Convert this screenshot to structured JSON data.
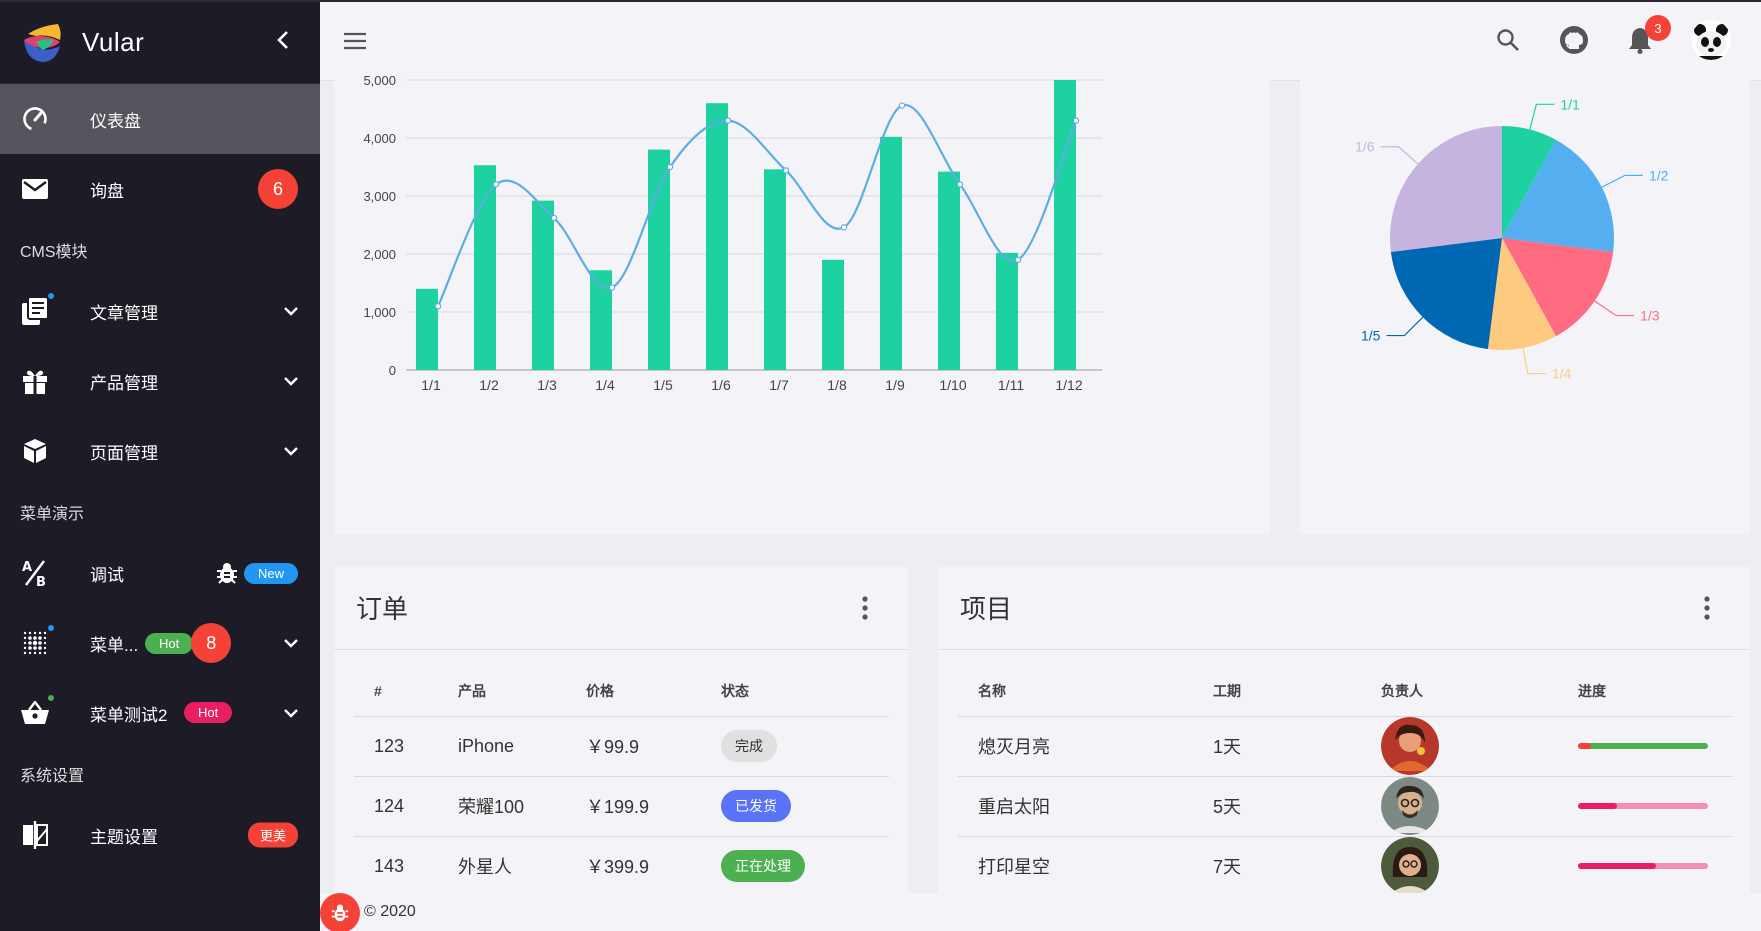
{
  "app": {
    "name": "Vular"
  },
  "sidebar": {
    "items": [
      {
        "label": "仪表盘",
        "icon": "speedometer-icon"
      },
      {
        "label": "询盘",
        "icon": "mail-icon",
        "badge": "6"
      }
    ],
    "sections": [
      {
        "title": "CMS模块",
        "items": [
          {
            "label": "文章管理",
            "icon": "articles-icon"
          },
          {
            "label": "产品管理",
            "icon": "gift-icon"
          },
          {
            "label": "页面管理",
            "icon": "cube-icon"
          }
        ]
      },
      {
        "title": "菜单演示",
        "items": [
          {
            "label": "调试",
            "icon": "debug-icon",
            "pill": "New"
          },
          {
            "label": "菜单...",
            "icon": "grid-dots-icon",
            "pill": "Hot",
            "badge": "8"
          },
          {
            "label": "菜单测试2",
            "icon": "basket-icon",
            "pill": "Hot"
          }
        ]
      },
      {
        "title": "系统设置",
        "items": [
          {
            "label": "主题设置",
            "icon": "theme-icon",
            "pill": "更美"
          }
        ]
      }
    ]
  },
  "topbar": {
    "notifications": "3"
  },
  "colors": {
    "accent": "#1dd1a1",
    "line": "#5dade2",
    "sidebar": "#1c1b26"
  },
  "chart_data": [
    {
      "type": "bar",
      "categories": [
        "1/1",
        "1/2",
        "1/3",
        "1/4",
        "1/5",
        "1/6",
        "1/7",
        "1/8",
        "1/9",
        "1/10",
        "1/11",
        "1/12"
      ],
      "series": [
        {
          "type": "bar",
          "values": [
            1400,
            3530,
            2920,
            1720,
            3800,
            4600,
            3460,
            1900,
            4020,
            3420,
            2020,
            5000
          ]
        },
        {
          "type": "line",
          "values": [
            1100,
            3200,
            2620,
            1420,
            3500,
            4300,
            3440,
            2460,
            4560,
            3200,
            1900,
            4300
          ]
        }
      ],
      "ylim": [
        0,
        5000
      ],
      "yticks": [
        "0",
        "1,000",
        "2,000",
        "3,000",
        "4,000",
        "5,000"
      ],
      "grid": true
    },
    {
      "type": "pie",
      "slices": [
        {
          "label": "1/1",
          "value": 8,
          "color": "#1dd1a1"
        },
        {
          "label": "1/2",
          "value": 19,
          "color": "#54aeef"
        },
        {
          "label": "1/3",
          "value": 15,
          "color": "#ff6b81"
        },
        {
          "label": "1/4",
          "value": 10,
          "color": "#feca80"
        },
        {
          "label": "1/5",
          "value": 21,
          "color": "#0068b3"
        },
        {
          "label": "1/6",
          "value": 27,
          "color": "#c5b3e0"
        }
      ]
    }
  ],
  "orders": {
    "title": "订单",
    "columns": [
      "#",
      "产品",
      "价格",
      "状态"
    ],
    "rows": [
      {
        "id": "123",
        "product": "iPhone",
        "price": "￥99.9",
        "status": "完成"
      },
      {
        "id": "124",
        "product": "荣耀100",
        "price": "￥199.9",
        "status": "已发货"
      },
      {
        "id": "143",
        "product": "外星人",
        "price": "￥399.9",
        "status": "正在处理"
      }
    ]
  },
  "projects": {
    "title": "项目",
    "columns": [
      "名称",
      "工期",
      "负责人",
      "进度"
    ],
    "rows": [
      {
        "name": "熄灭月亮",
        "duration": "1天",
        "progress": 0.1,
        "color": "#f44336",
        "color2": "#4caf50"
      },
      {
        "name": "重启太阳",
        "duration": "5天",
        "progress": 0.3,
        "color": "#e91e63",
        "color2": "#f48fb1"
      },
      {
        "name": "打印星空",
        "duration": "7天",
        "progress": 0.6,
        "color": "#e91e63",
        "color2": "#f48fb1"
      }
    ]
  },
  "footer": {
    "copyright": "© 2020"
  }
}
